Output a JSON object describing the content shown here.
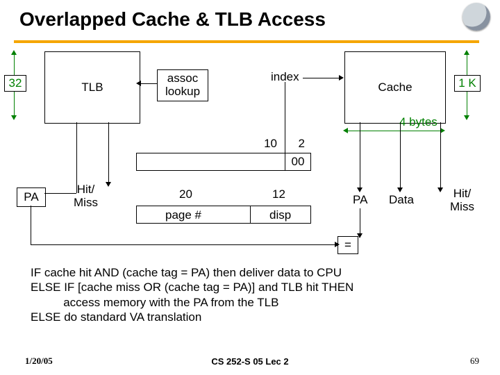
{
  "title": "Overlapped Cache & TLB Access",
  "leftBits": "32",
  "tlb": "TLB",
  "assoc": "assoc lookup",
  "index": "index",
  "cache": "Cache",
  "oneK": "1 K",
  "fourBytes": "4 bytes",
  "fld10": "10",
  "fld2": "2",
  "fld00": "00",
  "pa": "PA",
  "paRight": "PA",
  "hitMissL": "Hit/\nMiss",
  "hitMissR": "Hit/\nMiss",
  "twenty": "20",
  "pageNum": "page #",
  "twelve": "12",
  "disp": "disp",
  "dataLbl": "Data",
  "eq": "=",
  "pseudo": "IF cache hit AND (cache tag = PA) then deliver data to CPU\nELSE IF [cache miss OR (cache tag = PA)] and TLB hit THEN\n          access memory with the PA from the TLB\nELSE do standard VA translation",
  "footerLeft": "1/20/05",
  "footerCenter": "CS 252-S 05 Lec 2",
  "footerRight": "69"
}
